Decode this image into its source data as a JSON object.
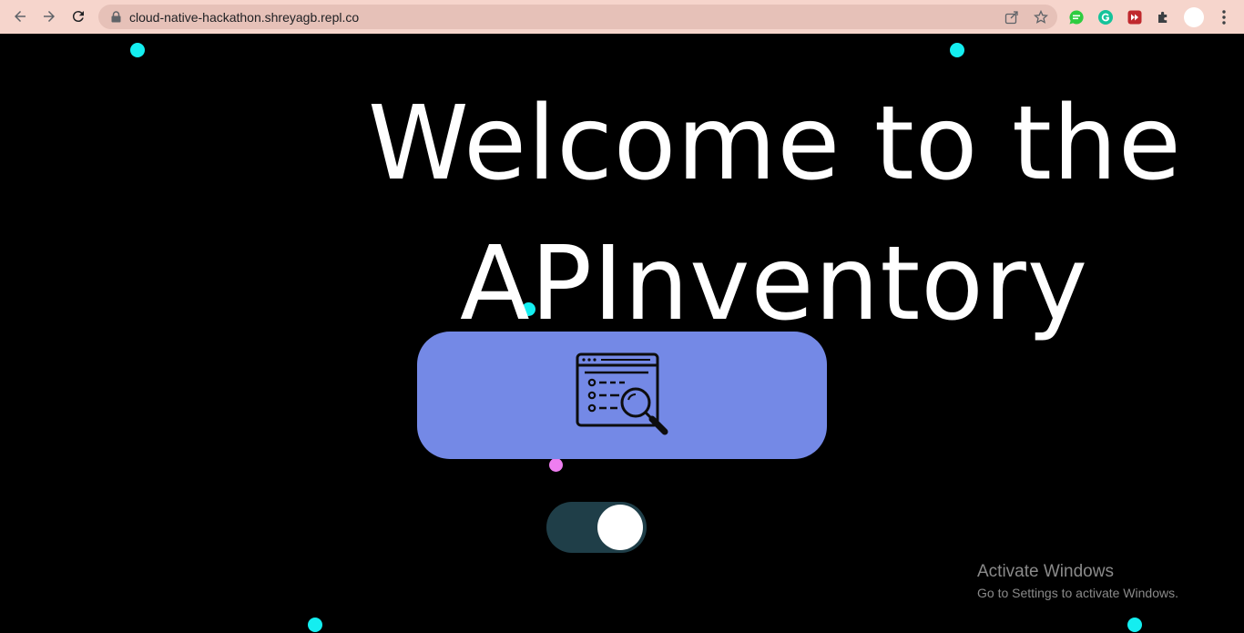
{
  "browser": {
    "url": "cloud-native-hackathon.shreyagb.repl.co"
  },
  "headline": {
    "line1": "Welcome to the",
    "line2": "APInventory"
  },
  "theme": {
    "card_color": "#7489e6",
    "toggle_color": "#1f3e48",
    "dot_cyan": "#14eef0",
    "dot_pink": "#ee7ef0"
  },
  "toggle": {
    "state": "on"
  },
  "watermark": {
    "title": "Activate Windows",
    "subtitle": "Go to Settings to activate Windows."
  }
}
